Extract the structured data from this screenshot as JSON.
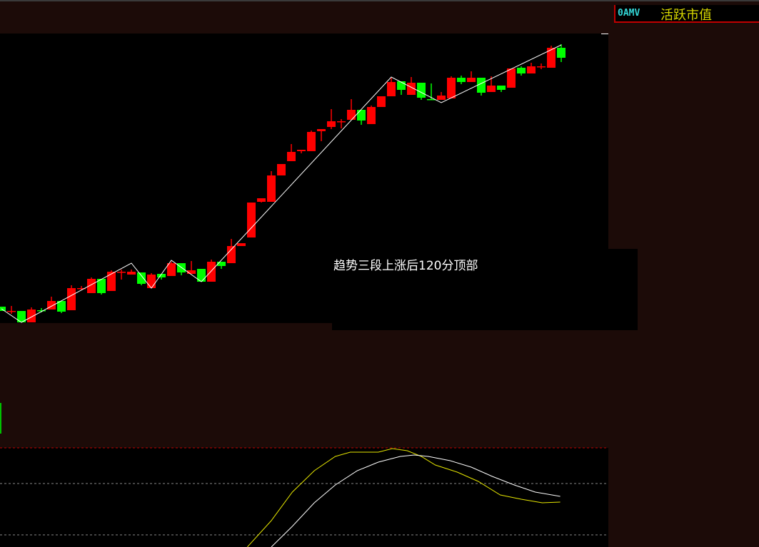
{
  "header": {
    "code": "0AMV",
    "name": "活跃市值"
  },
  "annotation": "趋势三段上涨后120分顶部",
  "colors": {
    "up": "#ff0000",
    "down": "#00ff00",
    "zigzag": "#ffffff",
    "fast_line": "#e6e600",
    "slow_line": "#ffffff",
    "bg": "#1c0b08"
  },
  "chart_data": {
    "type": "candlestick",
    "note": "price units arbitrary (no axis labels shown)",
    "candles": [
      [
        70,
        70,
        64,
        64
      ],
      [
        64,
        71,
        60,
        64
      ],
      [
        64,
        64,
        48,
        48
      ],
      [
        48,
        69,
        48,
        66
      ],
      [
        65,
        68,
        62,
        65
      ],
      [
        66,
        84,
        66,
        78
      ],
      [
        78,
        78,
        61,
        63
      ],
      [
        65,
        100,
        65,
        96
      ],
      [
        96,
        99,
        93,
        96
      ],
      [
        89,
        111,
        89,
        109
      ],
      [
        109,
        109,
        87,
        89
      ],
      [
        92,
        121,
        92,
        119
      ],
      [
        119,
        122,
        108,
        119
      ],
      [
        115,
        122,
        115,
        119
      ],
      [
        118,
        118,
        100,
        102
      ],
      [
        96,
        117,
        96,
        115
      ],
      [
        116,
        116,
        108,
        111
      ],
      [
        113,
        133,
        113,
        131
      ],
      [
        131,
        131,
        114,
        118
      ],
      [
        116,
        134,
        116,
        121
      ],
      [
        123,
        123,
        105,
        105
      ],
      [
        105,
        136,
        105,
        133
      ],
      [
        133,
        133,
        123,
        127
      ],
      [
        131,
        165,
        131,
        155
      ],
      [
        155,
        159,
        155,
        159
      ],
      [
        167,
        216,
        167,
        216
      ],
      [
        217,
        222,
        216,
        222
      ],
      [
        217,
        260,
        217,
        254
      ],
      [
        254,
        270,
        254,
        270
      ],
      [
        274,
        298,
        274,
        287
      ],
      [
        288,
        290,
        285,
        290
      ],
      [
        288,
        317,
        288,
        315
      ],
      [
        316,
        319,
        302,
        319
      ],
      [
        322,
        347,
        319,
        330
      ],
      [
        330,
        333,
        320,
        330
      ],
      [
        332,
        361,
        332,
        346
      ],
      [
        346,
        346,
        325,
        331
      ],
      [
        326,
        352,
        326,
        350
      ],
      [
        350,
        365,
        350,
        365
      ],
      [
        365,
        391,
        365,
        385
      ],
      [
        386,
        386,
        367,
        374
      ],
      [
        367,
        392,
        367,
        384
      ],
      [
        384,
        384,
        360,
        363
      ],
      [
        361,
        383,
        360,
        361
      ],
      [
        360,
        371,
        360,
        366
      ],
      [
        362,
        393,
        362,
        391
      ],
      [
        391,
        394,
        382,
        385
      ],
      [
        385,
        400,
        385,
        391
      ],
      [
        391,
        391,
        366,
        370
      ],
      [
        371,
        393,
        371,
        380
      ],
      [
        380,
        380,
        371,
        374
      ],
      [
        377,
        404,
        377,
        404
      ],
      [
        405,
        407,
        394,
        397
      ],
      [
        397,
        412,
        397,
        407
      ],
      [
        407,
        411,
        403,
        407
      ],
      [
        405,
        436,
        405,
        433
      ],
      [
        433,
        438,
        413,
        419
      ]
    ],
    "zigzag": [
      [
        0,
        67
      ],
      [
        2,
        48
      ],
      [
        13,
        131
      ],
      [
        15,
        96
      ],
      [
        17,
        135
      ],
      [
        20,
        105
      ],
      [
        39,
        392
      ],
      [
        44,
        356
      ],
      [
        56,
        437
      ]
    ],
    "indicator": {
      "levels": [
        139,
        89,
        17
      ],
      "series": [
        {
          "name": "fast",
          "points": [
            [
              24.6,
              0
            ],
            [
              27,
              37
            ],
            [
              29.1,
              77
            ],
            [
              31.3,
              107
            ],
            [
              33.4,
              127
            ],
            [
              34.9,
              133
            ],
            [
              37.7,
              133
            ],
            [
              39.1,
              138
            ],
            [
              40.6,
              135
            ],
            [
              42,
              127
            ],
            [
              43.4,
              115
            ],
            [
              45.6,
              105
            ],
            [
              47.7,
              92
            ],
            [
              49.9,
              73
            ],
            [
              52,
              67
            ],
            [
              54.1,
              62
            ],
            [
              55.9,
              63
            ]
          ]
        },
        {
          "name": "slow",
          "points": [
            [
              27,
              0
            ],
            [
              29.1,
              29
            ],
            [
              31.3,
              62
            ],
            [
              33.4,
              87
            ],
            [
              35.6,
              107
            ],
            [
              37.7,
              119
            ],
            [
              39.9,
              127
            ],
            [
              41.3,
              129
            ],
            [
              42.7,
              127
            ],
            [
              44.9,
              121
            ],
            [
              47,
              112
            ],
            [
              49.1,
              99
            ],
            [
              51.3,
              87
            ],
            [
              53.4,
              77
            ],
            [
              55.9,
              71
            ]
          ]
        }
      ]
    }
  }
}
